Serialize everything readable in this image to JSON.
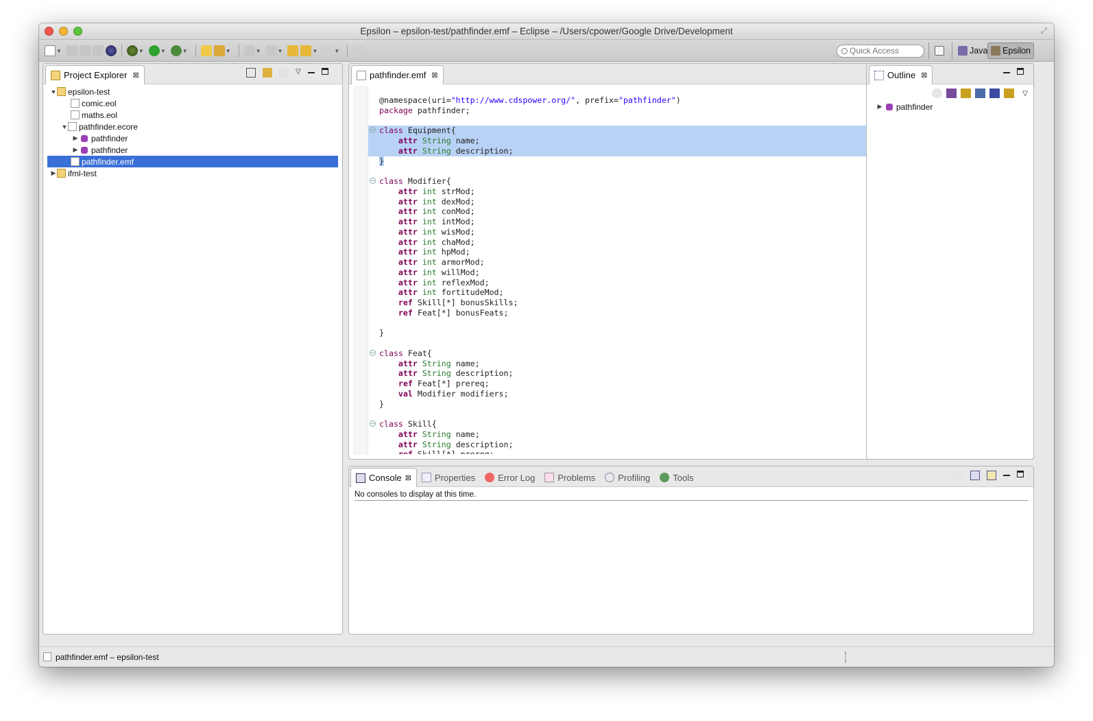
{
  "window": {
    "title": "Epsilon – epsilon-test/pathfinder.emf – Eclipse – /Users/cpower/Google Drive/Development"
  },
  "toolbar": {
    "quick_access_placeholder": "Quick Access",
    "perspectives": [
      {
        "label": "Java",
        "active": false
      },
      {
        "label": "Epsilon",
        "active": true
      }
    ]
  },
  "project_explorer": {
    "tab_label": "Project Explorer",
    "tree": [
      {
        "label": "epsilon-test",
        "depth": 0,
        "expanded": true,
        "kind": "project"
      },
      {
        "label": "comic.eol",
        "depth": 1,
        "kind": "file"
      },
      {
        "label": "maths.eol",
        "depth": 1,
        "kind": "file"
      },
      {
        "label": "pathfinder.ecore",
        "depth": 1,
        "expanded": true,
        "kind": "ecore"
      },
      {
        "label": "pathfinder",
        "depth": 2,
        "expanded": false,
        "kind": "package"
      },
      {
        "label": "pathfinder",
        "depth": 2,
        "expanded": false,
        "kind": "package"
      },
      {
        "label": "pathfinder.emf",
        "depth": 1,
        "kind": "emf",
        "selected": true
      },
      {
        "label": "ifml-test",
        "depth": 0,
        "expanded": false,
        "kind": "project"
      }
    ]
  },
  "editor": {
    "tab_label": "pathfinder.emf",
    "highlight_color": "#b8d2f5"
  },
  "outline": {
    "tab_label": "Outline",
    "tree": [
      {
        "label": "pathfinder",
        "expanded": false
      }
    ]
  },
  "console": {
    "tabs": [
      {
        "label": "Console",
        "active": true
      },
      {
        "label": "Properties",
        "active": false
      },
      {
        "label": "Error Log",
        "active": false
      },
      {
        "label": "Problems",
        "active": false
      },
      {
        "label": "Profiling",
        "active": false
      },
      {
        "label": "Tools",
        "active": false
      }
    ],
    "message": "No consoles to display at this time."
  },
  "statusbar": {
    "text": "pathfinder.emf – epsilon-test"
  },
  "colors": {
    "selection": "#3a6fd8",
    "keyword": "#7f0055",
    "type": "#2a7a2a",
    "string": "#2a00ff"
  }
}
